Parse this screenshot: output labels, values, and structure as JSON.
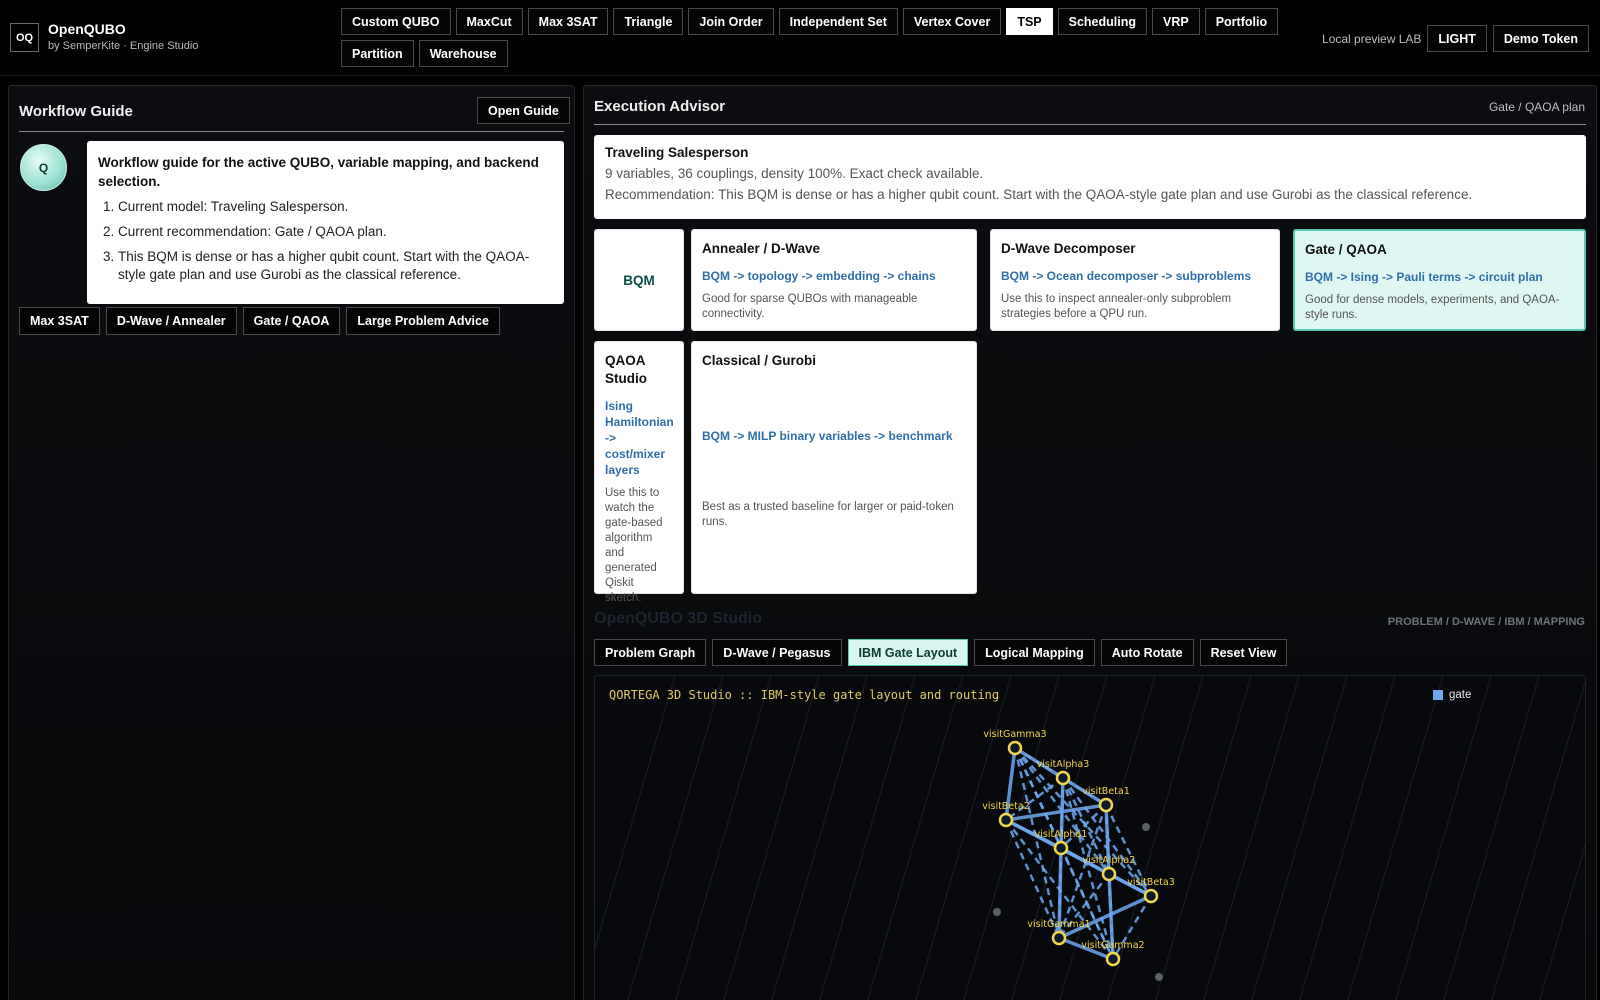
{
  "header": {
    "logo": "OQ",
    "app_name": "OpenQUBO",
    "app_sub": "by SemperKite · Engine Studio",
    "tabs": [
      {
        "label": "Custom QUBO",
        "active": false
      },
      {
        "label": "MaxCut",
        "active": false
      },
      {
        "label": "Max 3SAT",
        "active": false
      },
      {
        "label": "Triangle",
        "active": false
      },
      {
        "label": "Join Order",
        "active": false
      },
      {
        "label": "Independent Set",
        "active": false
      },
      {
        "label": "Vertex Cover",
        "active": false
      },
      {
        "label": "TSP",
        "active": true
      },
      {
        "label": "Scheduling",
        "active": false
      },
      {
        "label": "VRP",
        "active": false
      },
      {
        "label": "Portfolio",
        "active": false
      },
      {
        "label": "Partition",
        "active": false
      },
      {
        "label": "Warehouse",
        "active": false
      }
    ],
    "preview_label": "Local preview LAB",
    "theme_button": "LIGHT",
    "token_button": "Demo Token"
  },
  "workflow": {
    "title": "Workflow Guide",
    "open_guide": "Open Guide",
    "avatar": "Q",
    "card_title": "Workflow guide for the active QUBO, variable mapping, and backend selection.",
    "steps": [
      "Current model: Traveling Salesperson.",
      "Current recommendation: Gate / QAOA plan.",
      "This BQM is dense or has a higher qubit count. Start with the QAOA-style gate plan and use Gurobi as the classical reference."
    ],
    "chips": [
      "Max 3SAT",
      "D-Wave / Annealer",
      "Gate / QAOA",
      "Large Problem Advice"
    ]
  },
  "advisor": {
    "title": "Execution Advisor",
    "subtitle": "Gate / QAOA plan",
    "summary_title": "Traveling Salesperson",
    "summary_line": "9 variables, 36 couplings, density 100%. Exact check available.",
    "summary_rec": "Recommendation: This BQM is dense or has a higher qubit count. Start with the QAOA-style gate plan and use Gurobi as the classical reference.",
    "bqm_label": "BQM",
    "cards": {
      "annealer": {
        "title": "Annealer / D-Wave",
        "path": "BQM -> topology -> embedding -> chains",
        "desc": "Good for sparse QUBOs with manageable connectivity."
      },
      "decomposer": {
        "title": "D-Wave Decomposer",
        "path": "BQM -> Ocean decomposer -> subproblems",
        "desc": "Use this to inspect annealer-only subproblem strategies before a QPU run."
      },
      "gate": {
        "title": "Gate / QAOA",
        "path": "BQM -> Ising -> Pauli terms -> circuit plan",
        "desc": "Good for dense models, experiments, and QAOA-style runs."
      },
      "qaoa": {
        "title": "QAOA Studio",
        "path": "Ising Hamiltonian -> cost/mixer layers",
        "desc": "Use this to watch the gate-based algorithm and generated Qiskit sketch."
      },
      "classical": {
        "title": "Classical / Gurobi",
        "path": "BQM -> MILP binary variables -> benchmark",
        "desc": "Best as a trusted baseline for larger or paid-token runs."
      }
    }
  },
  "studio": {
    "title": "OpenQUBO 3D Studio",
    "subtitle": "PROBLEM / D-WAVE / IBM / MAPPING",
    "tabs": [
      {
        "label": "Problem Graph",
        "active": false
      },
      {
        "label": "D-Wave / Pegasus",
        "active": false
      },
      {
        "label": "IBM Gate Layout",
        "active": true
      },
      {
        "label": "Logical Mapping",
        "active": false
      },
      {
        "label": "Auto Rotate",
        "active": false
      },
      {
        "label": "Reset View",
        "active": false
      }
    ],
    "viewport_title": "QORTEGA 3D Studio :: IBM-style gate layout and routing",
    "legend_label": "gate",
    "colors": {
      "edge": "#6fa8f0",
      "node": "#f2d64b",
      "label": "#f2d64b",
      "grid": "#1b2026"
    },
    "nodes": [
      {
        "label": "visitGamma3"
      },
      {
        "label": "visitAlpha3"
      },
      {
        "label": "visitBeta1"
      },
      {
        "label": "visitBeta2"
      },
      {
        "label": "visitAlpha1"
      },
      {
        "label": "visitAlpha2"
      },
      {
        "label": "visitBeta3"
      },
      {
        "label": "visitGamma1"
      },
      {
        "label": "visitGamma2"
      }
    ]
  }
}
